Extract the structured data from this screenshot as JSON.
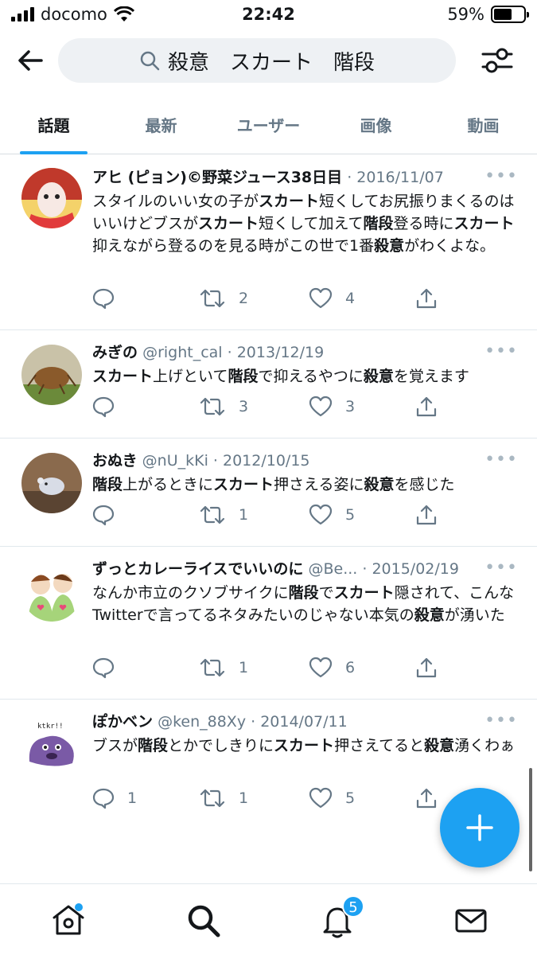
{
  "status": {
    "carrier": "docomo",
    "time": "22:42",
    "battery": "59%"
  },
  "search": {
    "query": "殺意　スカート　階段"
  },
  "tabs": [
    "話題",
    "最新",
    "ユーザー",
    "画像",
    "動画"
  ],
  "tweets": [
    {
      "name": "アヒ (ピョン)©野菜ジュース38日目",
      "handle": "",
      "date": "· 2016/11/07",
      "text": [
        {
          "t": "スタイルのいい女の子が"
        },
        {
          "t": "スカート",
          "b": true
        },
        {
          "t": "短くしてお尻振りまくるのはいいけどブスが"
        },
        {
          "t": "スカート",
          "b": true
        },
        {
          "t": "短くして加えて"
        },
        {
          "t": "階段",
          "b": true
        },
        {
          "t": "登る時に"
        },
        {
          "t": "スカート",
          "b": true
        },
        {
          "t": "抑えながら登るのを見る時がこの世で1番"
        },
        {
          "t": "殺意",
          "b": true
        },
        {
          "t": "がわくよな。"
        }
      ],
      "reply_count": "",
      "retweet_count": "2",
      "like_count": "4"
    },
    {
      "name": "みぎの",
      "handle": "@right_cal",
      "date": "· 2013/12/19",
      "text": [
        {
          "t": "スカート",
          "b": true
        },
        {
          "t": "上げといて"
        },
        {
          "t": "階段",
          "b": true
        },
        {
          "t": "で抑えるやつに"
        },
        {
          "t": "殺意",
          "b": true
        },
        {
          "t": "を覚えます"
        }
      ],
      "reply_count": "",
      "retweet_count": "3",
      "like_count": "3"
    },
    {
      "name": "おぬき",
      "handle": "@nU_kKi",
      "date": "· 2012/10/15",
      "text": [
        {
          "t": "階段",
          "b": true
        },
        {
          "t": "上がるときに"
        },
        {
          "t": "スカート",
          "b": true
        },
        {
          "t": "押さえる姿に"
        },
        {
          "t": "殺意",
          "b": true
        },
        {
          "t": "を感じた"
        }
      ],
      "reply_count": "",
      "retweet_count": "1",
      "like_count": "5"
    },
    {
      "name": "ずっとカレーライスでいいのに",
      "handle": "@Be...",
      "date": "· 2015/02/19",
      "text": [
        {
          "t": "なんか市立のクソブサイクに"
        },
        {
          "t": "階段",
          "b": true
        },
        {
          "t": "で"
        },
        {
          "t": "スカート",
          "b": true
        },
        {
          "t": "隠されて、こんなTwitterで言ってるネタみたいのじゃない本気の"
        },
        {
          "t": "殺意",
          "b": true
        },
        {
          "t": "が湧いた"
        }
      ],
      "reply_count": "",
      "retweet_count": "1",
      "like_count": "6"
    },
    {
      "name": "ぽかベン",
      "handle": "@ken_88Xy",
      "date": "· 2014/07/11",
      "avatar_text": "ktkr!!",
      "text": [
        {
          "t": "ブスが"
        },
        {
          "t": "階段",
          "b": true
        },
        {
          "t": "とかでしきりに"
        },
        {
          "t": "スカート",
          "b": true
        },
        {
          "t": "押さえてると"
        },
        {
          "t": "殺意",
          "b": true
        },
        {
          "t": "湧くわぁ"
        }
      ],
      "reply_count": "1",
      "retweet_count": "1",
      "like_count": "5"
    }
  ],
  "nav": {
    "notification_badge": "5"
  },
  "colors": {
    "accent": "#1da1f2",
    "text": "#14171a",
    "secondary": "#657786"
  }
}
